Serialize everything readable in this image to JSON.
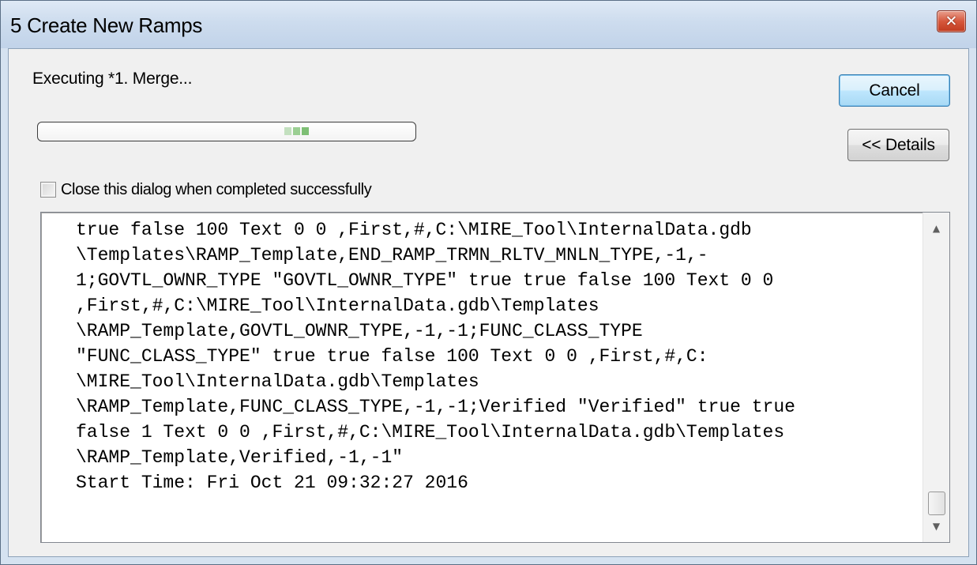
{
  "window": {
    "title": "5 Create New Ramps",
    "close_icon": "close-icon",
    "close_color": "#c7442a"
  },
  "status": {
    "text": "Executing *1. Merge..."
  },
  "progress": {
    "state": "marquee",
    "segment_colors": [
      "#c3e0bf",
      "#9bcf93",
      "#7ebf75"
    ]
  },
  "buttons": {
    "cancel_label": "Cancel",
    "details_label": "<< Details"
  },
  "checkbox": {
    "label": "Close this dialog when completed successfully",
    "checked": false
  },
  "log": {
    "lines": [
      "true false 100 Text 0 0 ,First,#,C:\\MIRE_Tool\\InternalData.gdb",
      "\\Templates\\RAMP_Template,END_RAMP_TRMN_RLTV_MNLN_TYPE,-1,-",
      "1;GOVTL_OWNR_TYPE \"GOVTL_OWNR_TYPE\" true true false 100 Text 0 0",
      ",First,#,C:\\MIRE_Tool\\InternalData.gdb\\Templates",
      "\\RAMP_Template,GOVTL_OWNR_TYPE,-1,-1;FUNC_CLASS_TYPE",
      "\"FUNC_CLASS_TYPE\" true true false 100 Text 0 0 ,First,#,C:",
      "\\MIRE_Tool\\InternalData.gdb\\Templates",
      "\\RAMP_Template,FUNC_CLASS_TYPE,-1,-1;Verified \"Verified\" true true",
      "false 1 Text 0 0 ,First,#,C:\\MIRE_Tool\\InternalData.gdb\\Templates",
      "\\RAMP_Template,Verified,-1,-1\"",
      "Start Time: Fri Oct 21 09:32:27 2016"
    ],
    "scroll_up_icon": "scroll-up-arrow-icon",
    "scroll_down_icon": "scroll-down-arrow-icon"
  }
}
